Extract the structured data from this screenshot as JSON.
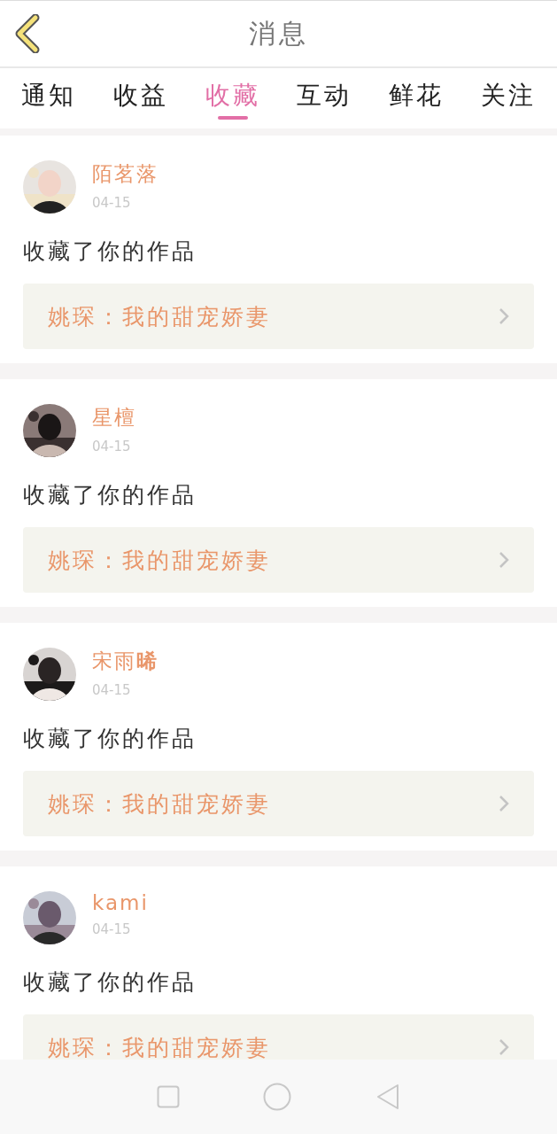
{
  "header": {
    "title": "消息"
  },
  "tabs": [
    {
      "label": "通知",
      "selected": false
    },
    {
      "label": "收益",
      "selected": false
    },
    {
      "label": "收藏",
      "selected": true
    },
    {
      "label": "互动",
      "selected": false
    },
    {
      "label": "鲜花",
      "selected": false
    },
    {
      "label": "关注",
      "selected": false
    }
  ],
  "messages": [
    {
      "name": "陌茗落",
      "date": "04-15",
      "text": "收藏了你的作品",
      "work": "姚琛：我的甜宠娇妻"
    },
    {
      "name": "星檀",
      "date": "04-15",
      "text": "收藏了你的作品",
      "work": "姚琛：我的甜宠娇妻"
    },
    {
      "name": "宋雨**晞**",
      "date": "04-15",
      "text": "收藏了你的作品",
      "work": "姚琛：我的甜宠娇妻"
    },
    {
      "name": "kami",
      "date": "04-15",
      "text": "收藏了你的作品",
      "work": "姚琛：我的甜宠娇妻"
    }
  ]
}
